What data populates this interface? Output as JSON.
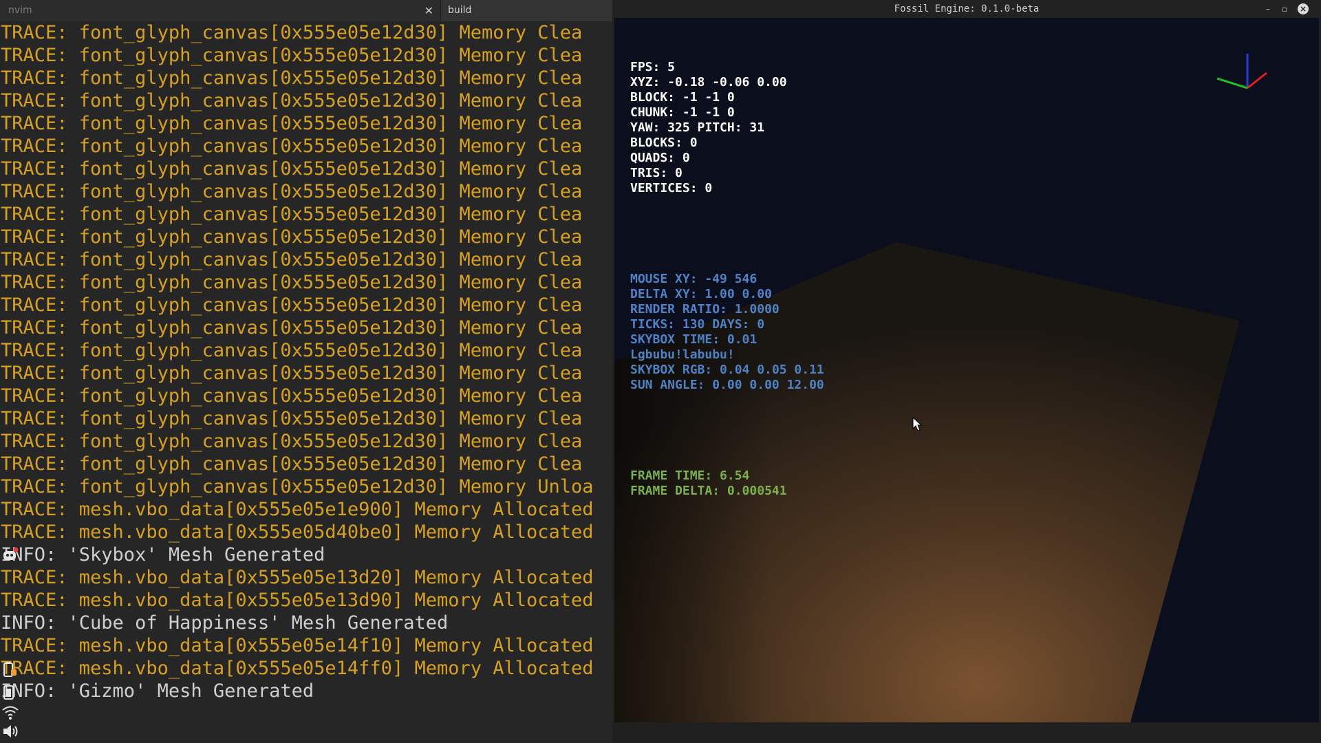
{
  "terminal": {
    "tabs": [
      {
        "label": "nvim"
      },
      {
        "label": "build"
      }
    ],
    "close_glyph": "✕",
    "lines": [
      {
        "type": "trace",
        "text": "TRACE: font_glyph_canvas[0x555e05e12d30] Memory Clea"
      },
      {
        "type": "trace",
        "text": "TRACE: font_glyph_canvas[0x555e05e12d30] Memory Clea"
      },
      {
        "type": "trace",
        "text": "TRACE: font_glyph_canvas[0x555e05e12d30] Memory Clea"
      },
      {
        "type": "trace",
        "text": "TRACE: font_glyph_canvas[0x555e05e12d30] Memory Clea"
      },
      {
        "type": "trace",
        "text": "TRACE: font_glyph_canvas[0x555e05e12d30] Memory Clea"
      },
      {
        "type": "trace",
        "text": "TRACE: font_glyph_canvas[0x555e05e12d30] Memory Clea"
      },
      {
        "type": "trace",
        "text": "TRACE: font_glyph_canvas[0x555e05e12d30] Memory Clea"
      },
      {
        "type": "trace",
        "text": "TRACE: font_glyph_canvas[0x555e05e12d30] Memory Clea"
      },
      {
        "type": "trace",
        "text": "TRACE: font_glyph_canvas[0x555e05e12d30] Memory Clea"
      },
      {
        "type": "trace",
        "text": "TRACE: font_glyph_canvas[0x555e05e12d30] Memory Clea"
      },
      {
        "type": "trace",
        "text": "TRACE: font_glyph_canvas[0x555e05e12d30] Memory Clea"
      },
      {
        "type": "trace",
        "text": "TRACE: font_glyph_canvas[0x555e05e12d30] Memory Clea"
      },
      {
        "type": "trace",
        "text": "TRACE: font_glyph_canvas[0x555e05e12d30] Memory Clea"
      },
      {
        "type": "trace",
        "text": "TRACE: font_glyph_canvas[0x555e05e12d30] Memory Clea"
      },
      {
        "type": "trace",
        "text": "TRACE: font_glyph_canvas[0x555e05e12d30] Memory Clea"
      },
      {
        "type": "trace",
        "text": "TRACE: font_glyph_canvas[0x555e05e12d30] Memory Clea"
      },
      {
        "type": "trace",
        "text": "TRACE: font_glyph_canvas[0x555e05e12d30] Memory Clea"
      },
      {
        "type": "trace",
        "text": "TRACE: font_glyph_canvas[0x555e05e12d30] Memory Clea"
      },
      {
        "type": "trace",
        "text": "TRACE: font_glyph_canvas[0x555e05e12d30] Memory Clea"
      },
      {
        "type": "trace",
        "text": "TRACE: font_glyph_canvas[0x555e05e12d30] Memory Clea"
      },
      {
        "type": "trace",
        "text": "TRACE: font_glyph_canvas[0x555e05e12d30] Memory Unloa"
      },
      {
        "type": "trace",
        "text": "TRACE: mesh.vbo_data[0x555e05e1e900] Memory Allocated"
      },
      {
        "type": "trace",
        "text": "TRACE: mesh.vbo_data[0x555e05d40be0] Memory Allocated"
      },
      {
        "type": "info",
        "text": "INFO: 'Skybox' Mesh Generated"
      },
      {
        "type": "trace",
        "text": "TRACE: mesh.vbo_data[0x555e05e13d20] Memory Allocated"
      },
      {
        "type": "trace",
        "text": "TRACE: mesh.vbo_data[0x555e05e13d90] Memory Allocated"
      },
      {
        "type": "info",
        "text": "INFO: 'Cube of Happiness' Mesh Generated"
      },
      {
        "type": "trace",
        "text": "TRACE: mesh.vbo_data[0x555e05e14f10] Memory Allocated"
      },
      {
        "type": "trace",
        "text": "TRACE: mesh.vbo_data[0x555e05e14ff0] Memory Allocated"
      },
      {
        "type": "info",
        "text": "INFO: 'Gizmo' Mesh Generated"
      }
    ],
    "tray_icons": [
      "discord-icon",
      "battery-icon",
      "wifi-icon",
      "volume-icon"
    ],
    "colors": {
      "trace": "#d6a11e",
      "info": "#cfcfcf",
      "background": "#262626"
    }
  },
  "game_window": {
    "title": "Fossil Engine: 0.1.0-beta",
    "controls": {
      "minimize": "–",
      "maximize": "▫",
      "close": "×"
    },
    "hud": {
      "white": [
        "FPS: 5",
        "XYZ: -0.18 -0.06 0.00",
        "BLOCK: -1 -1 0",
        "CHUNK: -1 -1 0",
        "YAW: 325 PITCH: 31",
        "BLOCKS: 0",
        "QUADS: 0",
        "TRIS: 0",
        "VERTICES: 0"
      ],
      "blue": [
        "MOUSE XY: -49 546",
        "DELTA XY: 1.00 0.00",
        "RENDER RATIO: 1.0000",
        "TICKS: 130 DAYS: 0",
        "SKYBOX TIME: 0.01",
        "Lgbubu!labubu!",
        "SKYBOX RGB: 0.04 0.05 0.11",
        "SUN ANGLE: 0.00 0.00 12.00"
      ],
      "green": [
        "FRAME TIME: 6.54",
        "FRAME DELTA: 0.000541"
      ]
    },
    "colors": {
      "sky": "#0b0e1c",
      "cube_dark": "#1e1712",
      "cube_light": "#6e4a2a",
      "gizmo_x": "#e02020",
      "gizmo_y": "#2040e0",
      "gizmo_z": "#20c020",
      "hud_white": "#ffffff",
      "hud_blue": "#4d82c4",
      "hud_green": "#7bb04b"
    }
  }
}
